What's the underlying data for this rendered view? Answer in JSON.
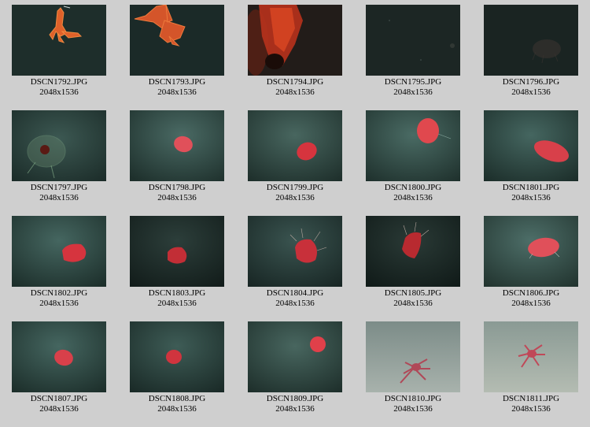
{
  "thumbnails": [
    {
      "filename": "DSCN1792.JPG",
      "dimensions": "2048x1536",
      "subject": "orange-shrimp-larva-icon"
    },
    {
      "filename": "DSCN1793.JPG",
      "dimensions": "2048x1536",
      "subject": "orange-shrimp-larva-icon"
    },
    {
      "filename": "DSCN1794.JPG",
      "dimensions": "2048x1536",
      "subject": "red-blurry-creature-icon"
    },
    {
      "filename": "DSCN1795.JPG",
      "dimensions": "2048x1536",
      "subject": "dark-water-icon"
    },
    {
      "filename": "DSCN1796.JPG",
      "dimensions": "2048x1536",
      "subject": "faint-jellyfish-icon"
    },
    {
      "filename": "DSCN1797.JPG",
      "dimensions": "2048x1536",
      "subject": "translucent-jellyfish-icon"
    },
    {
      "filename": "DSCN1798.JPG",
      "dimensions": "2048x1536",
      "subject": "red-jellyfish-icon"
    },
    {
      "filename": "DSCN1799.JPG",
      "dimensions": "2048x1536",
      "subject": "red-jellyfish-icon"
    },
    {
      "filename": "DSCN1800.JPG",
      "dimensions": "2048x1536",
      "subject": "red-jellyfish-icon"
    },
    {
      "filename": "DSCN1801.JPG",
      "dimensions": "2048x1536",
      "subject": "red-jellyfish-icon"
    },
    {
      "filename": "DSCN1802.JPG",
      "dimensions": "2048x1536",
      "subject": "red-jellyfish-icon"
    },
    {
      "filename": "DSCN1803.JPG",
      "dimensions": "2048x1536",
      "subject": "red-jellyfish-icon"
    },
    {
      "filename": "DSCN1804.JPG",
      "dimensions": "2048x1536",
      "subject": "red-jellyfish-tentacles-icon"
    },
    {
      "filename": "DSCN1805.JPG",
      "dimensions": "2048x1536",
      "subject": "red-jellyfish-tentacles-icon"
    },
    {
      "filename": "DSCN1806.JPG",
      "dimensions": "2048x1536",
      "subject": "red-jellyfish-icon"
    },
    {
      "filename": "DSCN1807.JPG",
      "dimensions": "2048x1536",
      "subject": "red-jellyfish-icon"
    },
    {
      "filename": "DSCN1808.JPG",
      "dimensions": "2048x1536",
      "subject": "red-jellyfish-icon"
    },
    {
      "filename": "DSCN1809.JPG",
      "dimensions": "2048x1536",
      "subject": "red-jellyfish-icon"
    },
    {
      "filename": "DSCN1810.JPG",
      "dimensions": "2048x1536",
      "subject": "red-crab-on-seafloor-icon"
    },
    {
      "filename": "DSCN1811.JPG",
      "dimensions": "2048x1536",
      "subject": "red-crab-on-seafloor-icon"
    }
  ],
  "colors": {
    "page_background": "#cfcfcf",
    "caption_text": "#000000",
    "deep_water": "#1c2b28",
    "teal_water": "#31504b",
    "seafloor": "#8c9994",
    "jelly_red": "#d8404a",
    "larva_orange": "#e0612a"
  }
}
